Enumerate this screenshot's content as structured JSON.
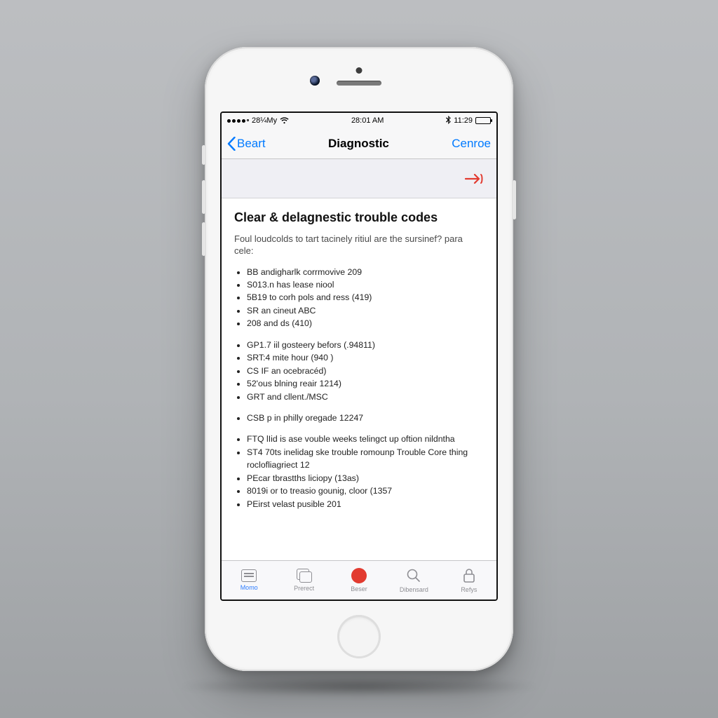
{
  "status": {
    "carrier": "28¼My",
    "time": "28:01 AM",
    "right_text": "11:29"
  },
  "nav": {
    "back_label": "Beart",
    "title": "Diagnostic",
    "right_label": "Cenroe"
  },
  "page": {
    "heading": "Clear & delagnestic trouble codes",
    "intro": "Foul loudcolds to tart tacinely ritiul are the sursinef? para cele:",
    "group1": [
      "BB andigharlk corrmovive 209",
      "S013.n has lease niool",
      "5B19 to corh pols and ress (419)",
      "SR an cineut ABC",
      "208 and ds (410)"
    ],
    "group2": [
      "GP1.7 iil gosteery befors (.94811)",
      "SRT:4 mite hour (940 )",
      "CS IF an ocebracéd)",
      "52'ous blning reair 1214)",
      "GRT and cllent./MSC"
    ],
    "group3": [
      "CSB p in philly oregade 12247"
    ],
    "group4": [
      "FTQ lIid is ase vouble weeks telingct up oftion nildntha",
      "ST4 70ts inelidag ske trouble romounp Trouble Core thing roclofliagriect 12",
      "PEcar tbrastths liciopy (13as)",
      "8019i or to treasio gounig, cloor (1357",
      "PEirst velast pusible 201"
    ]
  },
  "tabs": [
    {
      "label": "Momo"
    },
    {
      "label": "Prerect"
    },
    {
      "label": "Beser"
    },
    {
      "label": "Dibensard"
    },
    {
      "label": "Refys"
    }
  ]
}
